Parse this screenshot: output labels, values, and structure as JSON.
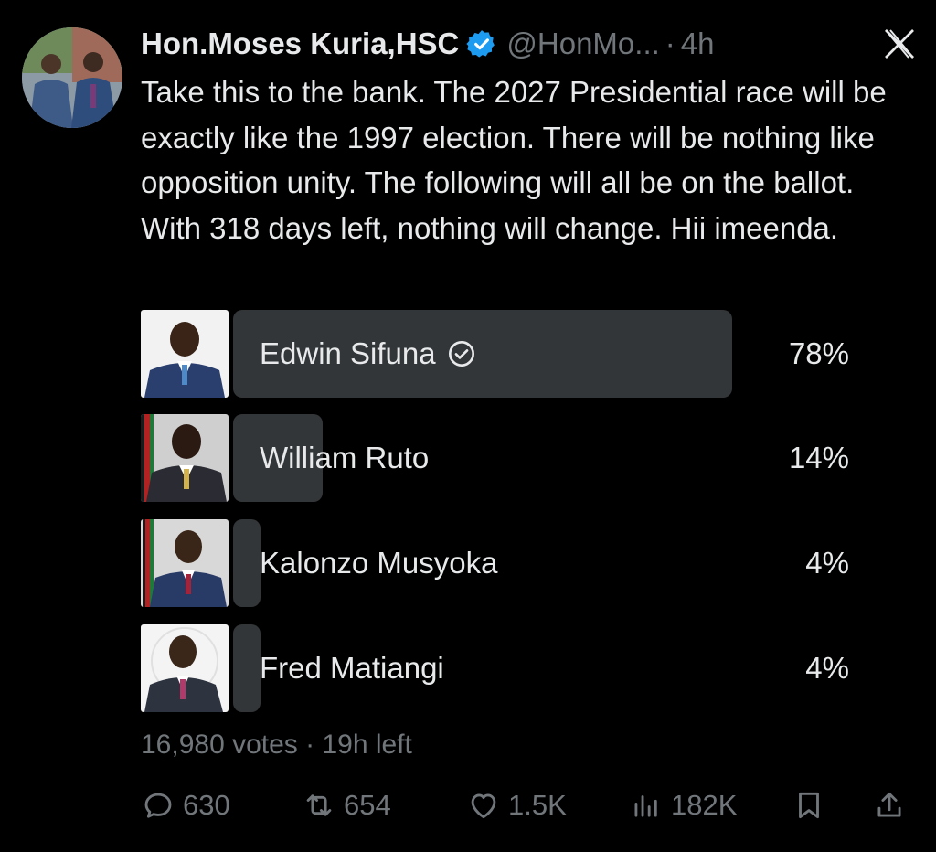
{
  "author": {
    "name": "Hon.Moses Kuria,HSC",
    "handle": "@HonMo...",
    "separator": "·",
    "time": "4h"
  },
  "tweet": {
    "text": "Take this to the bank. The 2027 Presidential race will be exactly like the 1997 election. There will be nothing like opposition unity. The following will all be on the ballot. With 318 days left, nothing will change. Hii imeenda."
  },
  "poll": {
    "options": [
      {
        "label": "Edwin Sifuna",
        "percent_text": "78%",
        "percent": 78,
        "winner": true
      },
      {
        "label": "William Ruto",
        "percent_text": "14%",
        "percent": 14,
        "winner": false
      },
      {
        "label": "Kalonzo Musyoka",
        "percent_text": "4%",
        "percent": 4,
        "winner": false
      },
      {
        "label": "Fred Matiangi",
        "percent_text": "4%",
        "percent": 4,
        "winner": false
      }
    ],
    "meta": "16,980 votes · 19h left"
  },
  "actions": {
    "replies": "630",
    "reposts": "654",
    "likes": "1.5K",
    "views": "182K"
  },
  "colors": {
    "background": "#000000",
    "text": "#e7e9ea",
    "muted": "#71767b",
    "bar": "#333639",
    "verified": "#1d9bf0"
  },
  "icons": [
    "verified-badge-icon",
    "x-logo-icon",
    "check-circle-icon",
    "reply-icon",
    "repost-icon",
    "like-icon",
    "views-icon",
    "bookmark-icon",
    "share-icon"
  ]
}
